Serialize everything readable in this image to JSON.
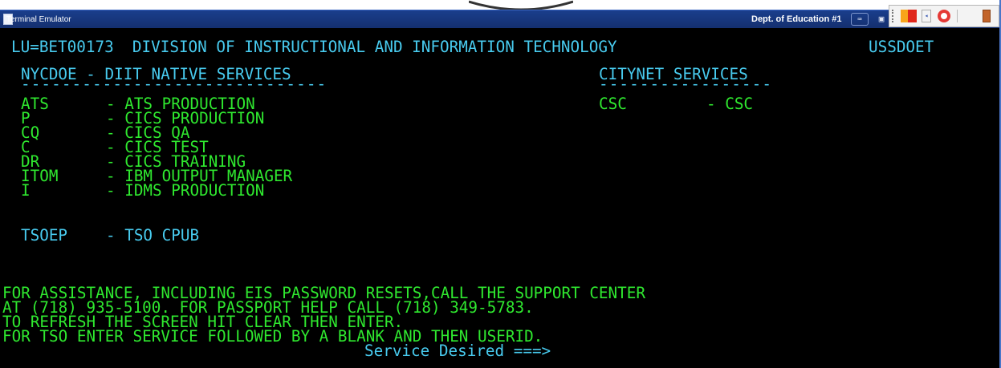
{
  "window": {
    "title": "Terminal Emulator",
    "session_name": "Dept. of Education #1",
    "buttons": {
      "keyboard": "⌨",
      "print": "▣"
    }
  },
  "overlay_toolbar": {
    "arrow": "◂"
  },
  "screen": {
    "header_left": "LU=BET00173  DIVISION OF INSTRUCTIONAL AND INFORMATION TECHNOLOGY",
    "header_right": "USSDOET",
    "native_title": "NYCDOE - DIIT NATIVE SERVICES",
    "native_underline": "------------------------------",
    "citynet_title": "CITYNET SERVICES",
    "citynet_underline": "-----------------",
    "native_services": [
      {
        "code": "ATS",
        "desc": "- ATS PRODUCTION"
      },
      {
        "code": "P",
        "desc": "- CICS PRODUCTION"
      },
      {
        "code": "CQ",
        "desc": "- CICS QA"
      },
      {
        "code": "C",
        "desc": "- CICS TEST"
      },
      {
        "code": "DR",
        "desc": "- CICS TRAINING"
      },
      {
        "code": "ITOM",
        "desc": "- IBM OUTPUT MANAGER"
      },
      {
        "code": "I",
        "desc": "- IDMS PRODUCTION"
      }
    ],
    "citynet_services": [
      {
        "code": "CSC",
        "desc": "- CSC"
      }
    ],
    "tso_service": {
      "code": "TSOEP",
      "desc": "- TSO CPUB"
    },
    "messages": [
      "FOR ASSISTANCE, INCLUDING EIS PASSWORD RESETS,CALL THE SUPPORT CENTER",
      "AT (718) 935-5100. FOR PASSPORT HELP CALL (718) 349-5783.",
      "TO REFRESH THE SCREEN HIT CLEAR THEN ENTER.",
      "FOR TSO ENTER SERVICE FOLLOWED BY A BLANK AND THEN USERID."
    ],
    "prompt": "Service Desired ===>",
    "colors": {
      "green": "#2fe82f",
      "cyan": "#48cbef",
      "background": "#000000"
    }
  }
}
